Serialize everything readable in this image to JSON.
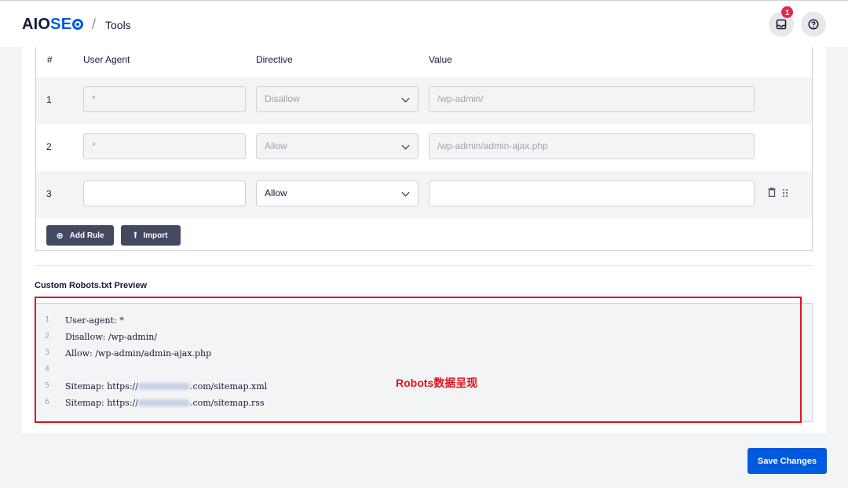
{
  "header": {
    "logo": {
      "aio": "AIO",
      "seo": "SE"
    },
    "breadcrumb_sep": "/",
    "breadcrumb": "Tools",
    "notification_count": "1",
    "notification_icon": "inbox-icon",
    "help_icon": "help-icon"
  },
  "rules_table": {
    "columns": [
      "#",
      "User Agent",
      "Directive",
      "Value"
    ],
    "rows": [
      {
        "num": "1",
        "user_agent": "*",
        "directive": "Disallow",
        "value": "/wp-admin/",
        "editable": false
      },
      {
        "num": "2",
        "user_agent": "*",
        "directive": "Allow",
        "value": "/wp-admin/admin-ajax.php",
        "editable": false
      },
      {
        "num": "3",
        "user_agent": "",
        "directive": "Allow",
        "value": "",
        "editable": true
      }
    ],
    "add_rule_label": "Add Rule",
    "import_label": "Import"
  },
  "preview": {
    "title": "Custom Robots.txt Preview",
    "lines": [
      {
        "num": "1",
        "text": "User-agent: *"
      },
      {
        "num": "2",
        "text": "Disallow: /wp-admin/"
      },
      {
        "num": "3",
        "text": "Allow: /wp-admin/admin-ajax.php"
      },
      {
        "num": "4",
        "text": ""
      },
      {
        "num": "5",
        "prefix": "Sitemap: https://",
        "suffix": ".com/sitemap.xml"
      },
      {
        "num": "6",
        "prefix": "Sitemap: https://",
        "suffix": ".com/sitemap.rss"
      }
    ]
  },
  "annotation": {
    "label": "Robots数据呈现",
    "color": "#e0121f"
  },
  "footer": {
    "save_label": "Save Changes"
  },
  "colors": {
    "brand": "#005ae0",
    "dark_button": "#434960",
    "badge": "#df2a4a"
  }
}
